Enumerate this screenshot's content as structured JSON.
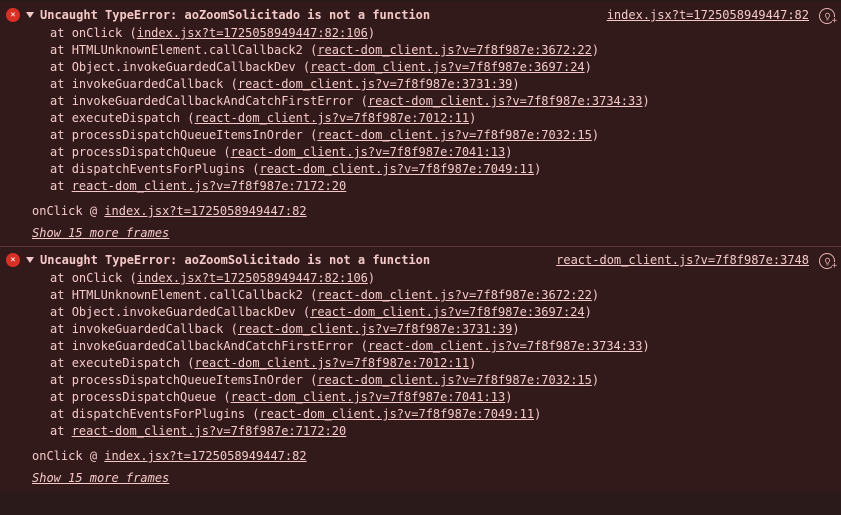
{
  "errors": [
    {
      "message": "Uncaught TypeError: aoZoomSolicitado is not a function",
      "source_link": "index.jsx?t=1725058949447:82",
      "frames": [
        {
          "fn": "onClick",
          "loc": "index.jsx?t=1725058949447:82:106"
        },
        {
          "fn": "HTMLUnknownElement.callCallback2",
          "loc": "react-dom_client.js?v=7f8f987e:3672:22"
        },
        {
          "fn": "Object.invokeGuardedCallbackDev",
          "loc": "react-dom_client.js?v=7f8f987e:3697:24"
        },
        {
          "fn": "invokeGuardedCallback",
          "loc": "react-dom_client.js?v=7f8f987e:3731:39"
        },
        {
          "fn": "invokeGuardedCallbackAndCatchFirstError",
          "loc": "react-dom_client.js?v=7f8f987e:3734:33"
        },
        {
          "fn": "executeDispatch",
          "loc": "react-dom_client.js?v=7f8f987e:7012:11"
        },
        {
          "fn": "processDispatchQueueItemsInOrder",
          "loc": "react-dom_client.js?v=7f8f987e:7032:15"
        },
        {
          "fn": "processDispatchQueue",
          "loc": "react-dom_client.js?v=7f8f987e:7041:13"
        },
        {
          "fn": "dispatchEventsForPlugins",
          "loc": "react-dom_client.js?v=7f8f987e:7049:11"
        },
        {
          "fn": "",
          "loc": "react-dom_client.js?v=7f8f987e:7172:20"
        }
      ],
      "origin_fn": "onClick",
      "origin_sep": "@",
      "origin_loc": "index.jsx?t=1725058949447:82",
      "show_more": "Show 15 more frames"
    },
    {
      "message": "Uncaught TypeError: aoZoomSolicitado is not a function",
      "source_link": "react-dom_client.js?v=7f8f987e:3748",
      "frames": [
        {
          "fn": "onClick",
          "loc": "index.jsx?t=1725058949447:82:106"
        },
        {
          "fn": "HTMLUnknownElement.callCallback2",
          "loc": "react-dom_client.js?v=7f8f987e:3672:22"
        },
        {
          "fn": "Object.invokeGuardedCallbackDev",
          "loc": "react-dom_client.js?v=7f8f987e:3697:24"
        },
        {
          "fn": "invokeGuardedCallback",
          "loc": "react-dom_client.js?v=7f8f987e:3731:39"
        },
        {
          "fn": "invokeGuardedCallbackAndCatchFirstError",
          "loc": "react-dom_client.js?v=7f8f987e:3734:33"
        },
        {
          "fn": "executeDispatch",
          "loc": "react-dom_client.js?v=7f8f987e:7012:11"
        },
        {
          "fn": "processDispatchQueueItemsInOrder",
          "loc": "react-dom_client.js?v=7f8f987e:7032:15"
        },
        {
          "fn": "processDispatchQueue",
          "loc": "react-dom_client.js?v=7f8f987e:7041:13"
        },
        {
          "fn": "dispatchEventsForPlugins",
          "loc": "react-dom_client.js?v=7f8f987e:7049:11"
        },
        {
          "fn": "",
          "loc": "react-dom_client.js?v=7f8f987e:7172:20"
        }
      ],
      "origin_fn": "onClick",
      "origin_sep": "@",
      "origin_loc": "index.jsx?t=1725058949447:82",
      "show_more": "Show 15 more frames"
    }
  ],
  "labels": {
    "at_prefix": "at "
  }
}
